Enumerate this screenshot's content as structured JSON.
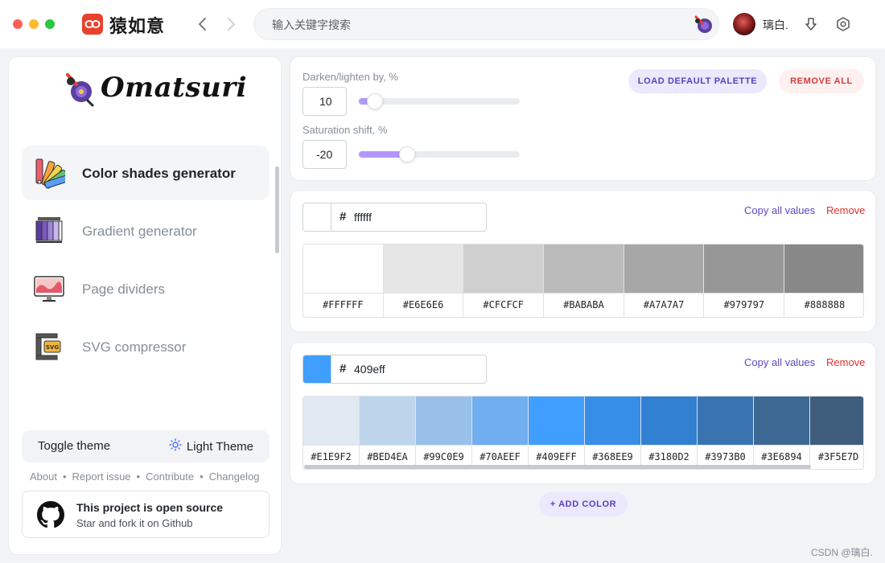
{
  "titlebar": {
    "app_name": "猿如意",
    "search": {
      "placeholder": "输入关键字搜索",
      "value": ""
    },
    "user_name": "璃白."
  },
  "sidebar": {
    "brand": "Omatsuri",
    "items": [
      {
        "label": "Color shades generator",
        "icon": "color-palette-icon",
        "active": true
      },
      {
        "label": "Gradient generator",
        "icon": "gradient-icon",
        "active": false
      },
      {
        "label": "Page dividers",
        "icon": "monitor-icon",
        "active": false
      },
      {
        "label": "SVG compressor",
        "icon": "svg-clamp-icon",
        "active": false
      }
    ],
    "theme": {
      "label": "Toggle theme",
      "value": "Light Theme"
    },
    "footer_links": [
      "About",
      "Report issue",
      "Contribute",
      "Changelog"
    ],
    "github": {
      "title": "This project is open source",
      "subtitle": "Star and fork it on Github"
    }
  },
  "controls": {
    "darken": {
      "label": "Darken/lighten by, %",
      "value": "10",
      "level": 0.1
    },
    "saturation": {
      "label": "Saturation shift, %",
      "value": "-20",
      "level": 0.3
    },
    "load_label": "LOAD DEFAULT PALETTE",
    "remove_all_label": "REMOVE ALL"
  },
  "colors": [
    {
      "hash": "#",
      "hex": "ffffff",
      "swatch": "#ffffff",
      "copy_label": "Copy all values",
      "remove_label": "Remove",
      "shades": [
        {
          "label": "#FFFFFF",
          "color": "#ffffff"
        },
        {
          "label": "#E6E6E6",
          "color": "#e6e6e6"
        },
        {
          "label": "#CFCFCF",
          "color": "#cfcfcf"
        },
        {
          "label": "#BABABA",
          "color": "#bababa"
        },
        {
          "label": "#A7A7A7",
          "color": "#a7a7a7"
        },
        {
          "label": "#979797",
          "color": "#979797"
        },
        {
          "label": "#888888",
          "color": "#888888"
        }
      ]
    },
    {
      "hash": "#",
      "hex": "409eff",
      "swatch": "#409eff",
      "copy_label": "Copy all values",
      "remove_label": "Remove",
      "shades": [
        {
          "label": "#E1E9F2",
          "color": "#e1e9f2"
        },
        {
          "label": "#BED4EA",
          "color": "#bed4ea"
        },
        {
          "label": "#99C0E9",
          "color": "#99c0e9"
        },
        {
          "label": "#70AEEF",
          "color": "#70aeef"
        },
        {
          "label": "#409EFF",
          "color": "#409eff"
        },
        {
          "label": "#368EE9",
          "color": "#368ee9"
        },
        {
          "label": "#3180D2",
          "color": "#3180d2"
        },
        {
          "label": "#3973B0",
          "color": "#3973b0"
        },
        {
          "label": "#3E6894",
          "color": "#3e6894"
        },
        {
          "label": "#3F5E7D",
          "color": "#3f5e7d"
        }
      ]
    }
  ],
  "add_color_label": "+ ADD COLOR",
  "watermark": "CSDN @璃白.",
  "accent_colors": {
    "primary": "#5c47c7",
    "danger": "#e03131",
    "slider": "#b197fc"
  }
}
